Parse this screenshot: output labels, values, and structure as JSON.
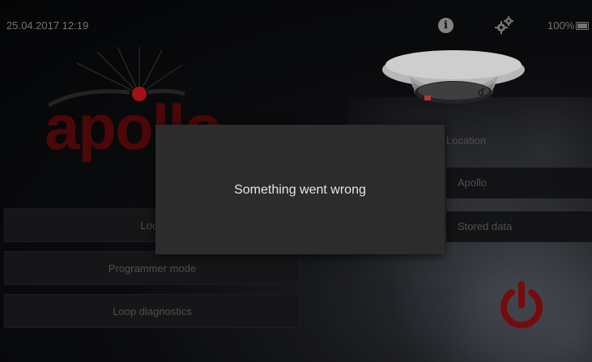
{
  "status_bar": {
    "datetime": "25.04.2017 12:19",
    "info_icon": "info-icon",
    "settings_icon": "settings-gears-icon",
    "battery_percent": "100%",
    "battery_icon": "battery-icon"
  },
  "logo": {
    "text": "apollo",
    "color": "#5a0a0a",
    "accent_color": "#c0141a"
  },
  "menu": {
    "loop_label": "Loop",
    "programmer_mode_label": "Programmer mode",
    "loop_diagnostics_label": "Loop diagnostics"
  },
  "right_panel": {
    "location_label": "Location",
    "location_value": "Apollo",
    "stored_data_label": "Stored data",
    "power_icon": "power-icon",
    "power_color": "#8b0d10"
  },
  "dialog": {
    "message": "Something went wrong"
  }
}
